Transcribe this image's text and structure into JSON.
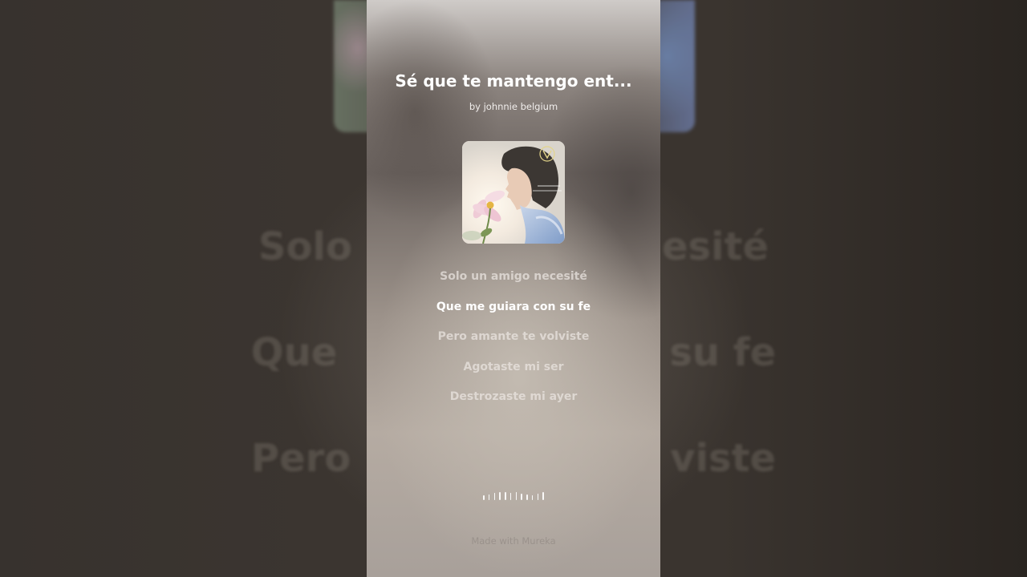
{
  "song": {
    "title": "Sé que te mantengo ent...",
    "artist": "by johnnie belgium"
  },
  "lyrics": [
    "Solo un amigo necesité",
    "Que me guiara con su fe",
    "Pero amante te volviste",
    "Agotaste mi ser",
    "Destrozaste mi ayer"
  ],
  "active_lyric_index": 1,
  "background_lyrics": {
    "line1_left": "Solo",
    "line1_right": "esité",
    "line2_left": "Que",
    "line2_right": "su fe",
    "line3_left": "Pero",
    "line3_right": "viste"
  },
  "footer": {
    "credit": "Made with Mureka"
  },
  "colors": {
    "text_primary": "#ffffff",
    "text_dim": "#ece6e2",
    "footer": "#968e88"
  },
  "icons": {
    "waveform": "audio-waveform-icon",
    "cover_badge": "v-logo-badge"
  }
}
